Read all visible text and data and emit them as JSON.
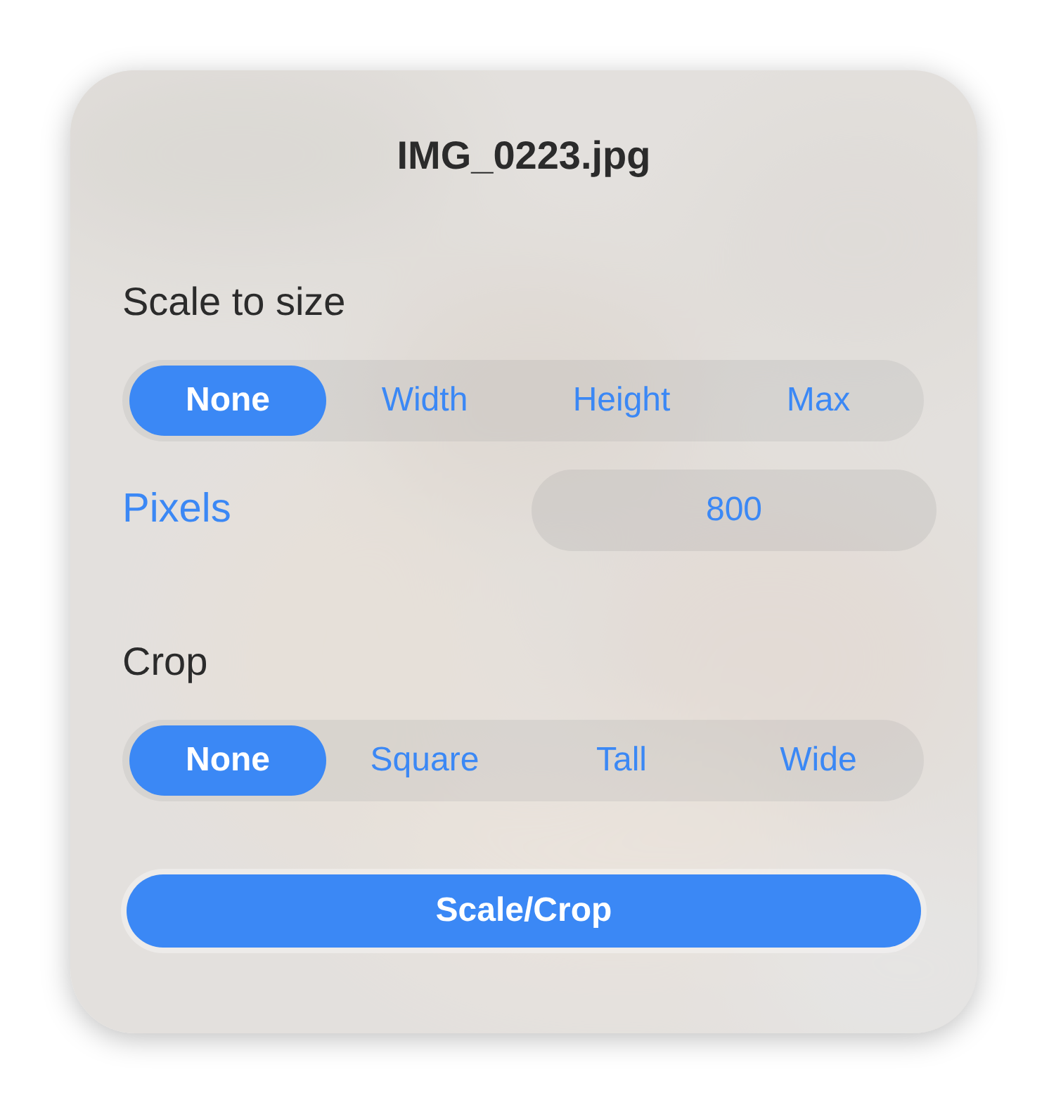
{
  "title": "IMG_0223.jpg",
  "scale": {
    "label": "Scale to size",
    "options": [
      {
        "label": "None",
        "selected": true
      },
      {
        "label": "Width",
        "selected": false
      },
      {
        "label": "Height",
        "selected": false
      },
      {
        "label": "Max",
        "selected": false
      }
    ]
  },
  "pixels": {
    "label": "Pixels",
    "value": "800"
  },
  "crop": {
    "label": "Crop",
    "options": [
      {
        "label": "None",
        "selected": true
      },
      {
        "label": "Square",
        "selected": false
      },
      {
        "label": "Tall",
        "selected": false
      },
      {
        "label": "Wide",
        "selected": false
      }
    ]
  },
  "button": "Scale/Crop"
}
